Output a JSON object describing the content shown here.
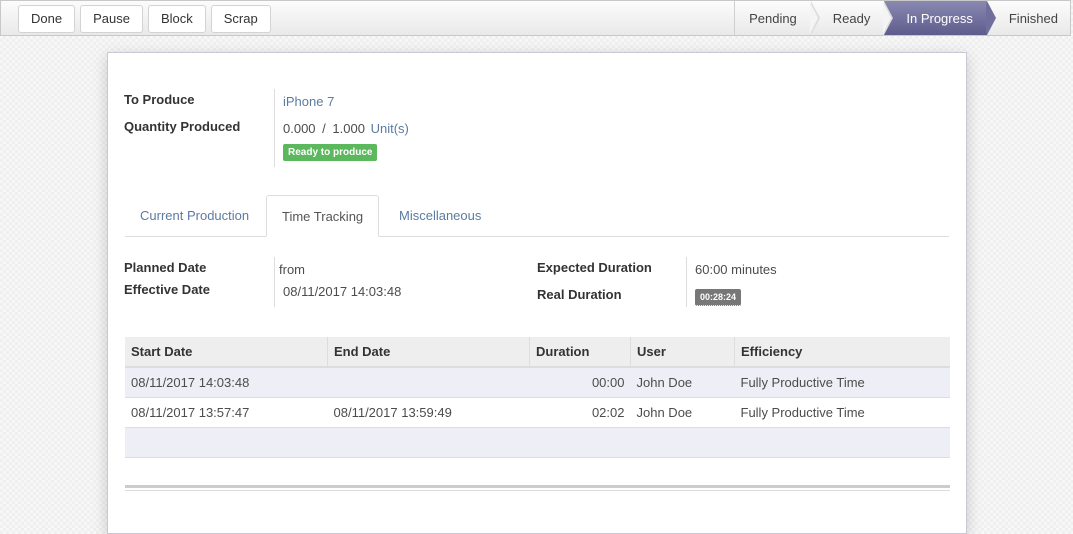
{
  "toolbar": {
    "buttons": [
      "Done",
      "Pause",
      "Block",
      "Scrap"
    ]
  },
  "stages": {
    "items": [
      "Pending",
      "Ready",
      "In Progress",
      "Finished"
    ],
    "active": "In Progress",
    "active_color": "#6f6e9c"
  },
  "form": {
    "to_produce_label": "To Produce",
    "to_produce_value": "iPhone 7",
    "qty_label": "Quantity Produced",
    "qty_produced": "0.000",
    "qty_sep": "/",
    "qty_total": "1.000",
    "qty_uom": "Unit(s)",
    "status_badge": "Ready to produce",
    "status_color": "#5cb85c"
  },
  "tabs": [
    "Current Production",
    "Time Tracking",
    "Miscellaneous"
  ],
  "active_tab": "Time Tracking",
  "time_tracking": {
    "planned_date_label": "Planned Date",
    "planned_date_value": "from",
    "effective_date_label": "Effective Date",
    "effective_date_value": "08/11/2017 14:03:48",
    "expected_duration_label": "Expected Duration",
    "expected_duration_value": "60:00 minutes",
    "real_duration_label": "Real Duration",
    "real_duration_value": "00:28:24"
  },
  "table": {
    "columns": [
      "Start Date",
      "End Date",
      "Duration",
      "User",
      "Efficiency"
    ],
    "rows": [
      [
        "08/11/2017 14:03:48",
        "",
        "00:00",
        "John Doe",
        "Fully Productive Time"
      ],
      [
        "08/11/2017 13:57:47",
        "08/11/2017 13:59:49",
        "02:02",
        "John Doe",
        "Fully Productive Time"
      ]
    ]
  }
}
